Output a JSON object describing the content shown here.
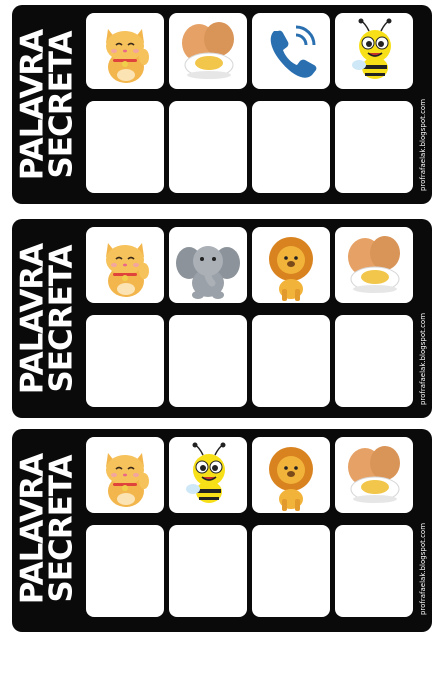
{
  "title_line1": "PALAVRA",
  "title_line2": "SECRETA",
  "blog": "profrafaelak.blogspot.com",
  "cards": [
    {
      "pictures": [
        "cat-icon",
        "egg-icon",
        "phone-icon",
        "bee-icon"
      ]
    },
    {
      "pictures": [
        "cat-icon",
        "elephant-icon",
        "lion-icon",
        "egg-icon"
      ]
    },
    {
      "pictures": [
        "cat-icon",
        "bee-icon",
        "lion-icon",
        "egg-icon"
      ]
    }
  ],
  "colors": {
    "card": "#0a0a0a",
    "tile": "#ffffff",
    "phone": "#2a6fb0",
    "bee": "#f7e017",
    "cat": "#f6c25b",
    "egg": "#e6a266",
    "lion": "#e39a2c",
    "elephant": "#9aa1a8"
  }
}
